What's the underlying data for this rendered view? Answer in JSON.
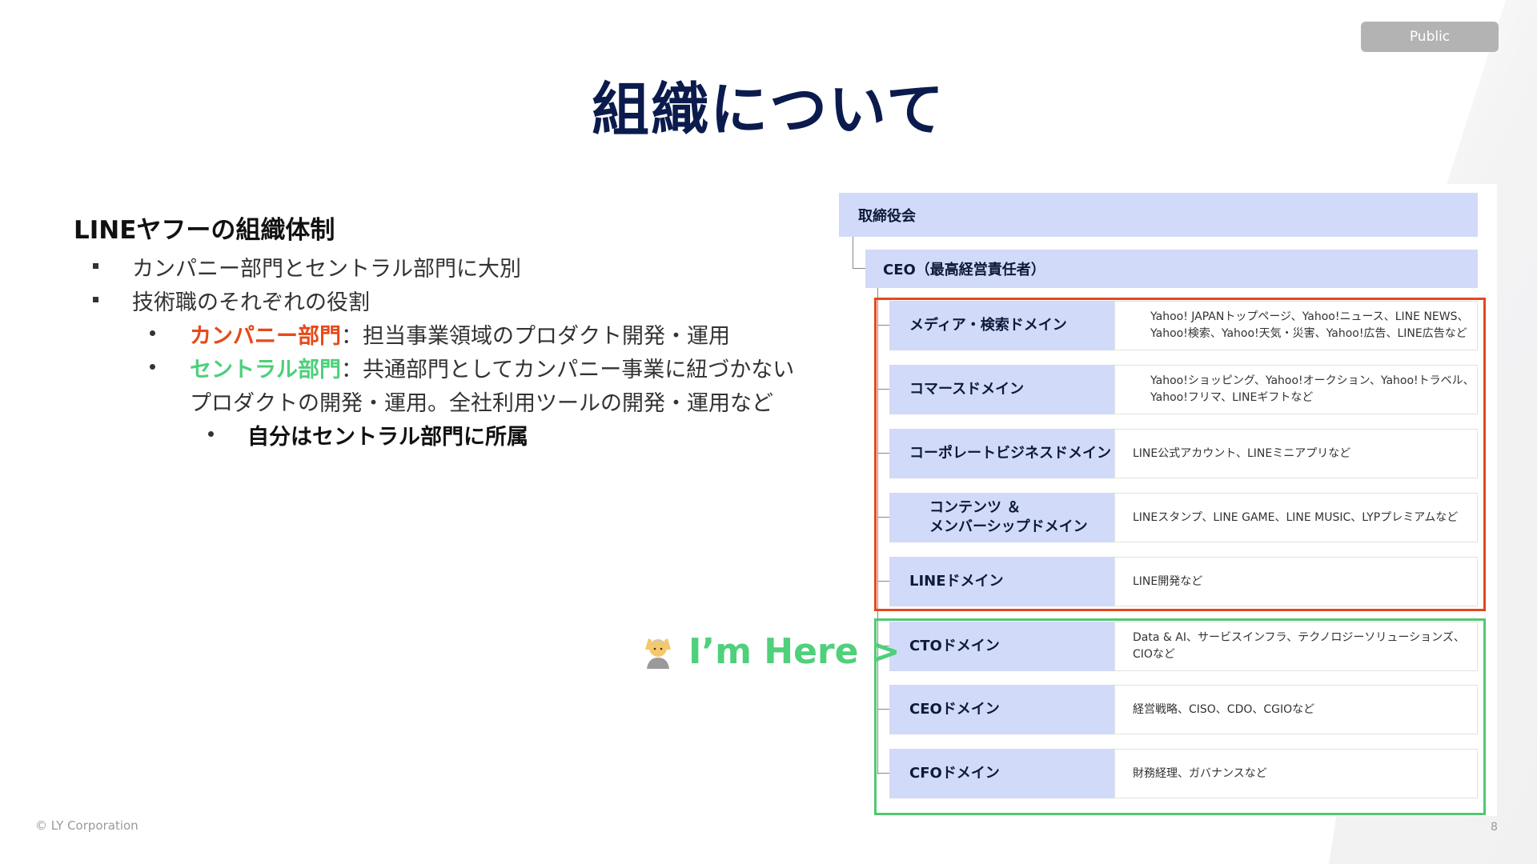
{
  "badge": "Public",
  "title": "組織について",
  "left": {
    "heading": "LINEヤフーの組織体制",
    "bullet1": "カンパニー部門とセントラル部門に大別",
    "bullet2": "技術職のそれぞれの役割",
    "sub1_label": "カンパニー部門",
    "sub1_text": "：担当事業領域のプロダクト開発・運用",
    "sub2_label": "セントラル部門",
    "sub2_text1": "：共通部門としてカンパニー事業に紐づかない",
    "sub2_text2": "プロダクトの開発・運用。全社利用ツールの開発・運用など",
    "sub3": "自分はセントラル部門に所属"
  },
  "org": {
    "board": "取締役会",
    "ceo": "CEO（最高経営責任者）",
    "rows": [
      {
        "name": "メディア・検索ドメイン",
        "desc1": "Yahoo! JAPANトップページ、Yahoo!ニュース、LINE NEWS、",
        "desc2": "Yahoo!検索、Yahoo!天気・災害、Yahoo!広告、LINE広告など"
      },
      {
        "name": "コマースドメイン",
        "desc1": "Yahoo!ショッピング、Yahoo!オークション、Yahoo!トラベル、",
        "desc2": "Yahoo!フリマ、LINEギフトなど"
      },
      {
        "name": "コーポレートビジネスドメイン",
        "desc1": "LINE公式アカウント、LINEミニアプリなど",
        "desc2": ""
      },
      {
        "name": "コンテンツ ＆",
        "name2": "メンバーシップドメイン",
        "desc1": "LINEスタンプ、LINE GAME、LINE MUSIC、LYPプレミアムなど",
        "desc2": ""
      },
      {
        "name": "LINEドメイン",
        "desc1": "LINE開発など",
        "desc2": ""
      },
      {
        "name": "CTOドメイン",
        "desc1": "Data & AI、サービスインフラ、テクノロジーソリューションズ、CIOなど",
        "desc2": ""
      },
      {
        "name": "CEOドメイン",
        "desc1": "経営戦略、CISO、CDO、CGIOなど",
        "desc2": ""
      },
      {
        "name": "CFOドメイン",
        "desc1": "財務経理、ガバナンスなど",
        "desc2": ""
      }
    ]
  },
  "here_label": "I’m Here >",
  "here_icon": "person-raising-hands-icon",
  "footer": {
    "copyright": "© LY Corporation",
    "page": "8"
  },
  "colors": {
    "title": "#0b1b4d",
    "company": "#e64a19",
    "central": "#4cd07a",
    "box_fill": "#d2daf9",
    "red_frame": "#e2491e",
    "green_frame": "#52c872"
  }
}
